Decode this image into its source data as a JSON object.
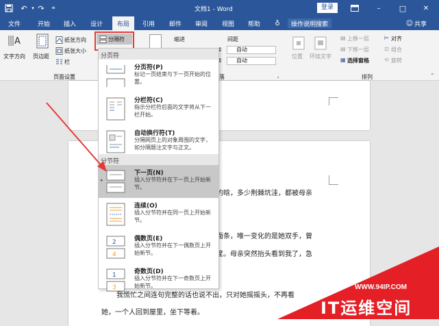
{
  "titlebar": {
    "title": "文档1 - Word",
    "login": "登录",
    "min": "–",
    "max": "□",
    "close": "✕",
    "accent": "#2b579a"
  },
  "tabs": [
    {
      "label": "文件"
    },
    {
      "label": "开始"
    },
    {
      "label": "插入"
    },
    {
      "label": "设计"
    },
    {
      "label": "布局"
    },
    {
      "label": "引用"
    },
    {
      "label": "邮件"
    },
    {
      "label": "审阅"
    },
    {
      "label": "视图"
    },
    {
      "label": "帮助"
    }
  ],
  "search": {
    "label": "操作说明搜索"
  },
  "share": {
    "label": "共享"
  },
  "ribbon": {
    "text_direction": "文字方向",
    "margins": "页边距",
    "orientation": "纸张方向",
    "size": "纸张大小",
    "columns": "栏",
    "breaks": "分隔符",
    "group_page_setup": "页面设置",
    "indent": "缩进",
    "spacing": "间距",
    "spacing_before": "自动",
    "spacing_after": "自动",
    "group_paragraph": "落",
    "position": "位置",
    "wrap_text": "环绕文字",
    "bring_forward": "上移一层",
    "send_backward": "下移一层",
    "selection_pane": "选择窗格",
    "align": "对齐",
    "group": "组合",
    "rotate": "旋转",
    "group_arrange": "排列"
  },
  "dropdown": {
    "header_page_breaks": "分页符",
    "header_section_breaks": "分节符",
    "items": [
      {
        "title": "分页符(P)",
        "desc": "标记一页结束与下一页开始的位置。"
      },
      {
        "title": "分栏符(C)",
        "desc": "指示分栏符后面的文字将从下一栏开始。"
      },
      {
        "title": "自动换行符(T)",
        "desc": "分隔网页上的对象周围的文字，如分隔题注文字与正文。"
      },
      {
        "title": "下一页(N)",
        "desc": "插入分节符并在下一页上开始新节。"
      },
      {
        "title": "连续(O)",
        "desc": "插入分节符并在同一页上开始新节。"
      },
      {
        "title": "偶数页(E)",
        "desc": "插入分节符并在下一偶数页上开始新节。"
      },
      {
        "title": "奇数页(D)",
        "desc": "插入分节符并在下一奇数页上开始新节。"
      }
    ]
  },
  "document": {
    "lines": [
      "的晗，多少荆棘坑洼，都被母亲",
      "面条，唯一变化的是她双手，曾",
      "筐。母亲突然抬头看到我了，急",
      "我慌忙之间连句完整的话也说不出，只对她摇摇头，不再看",
      "她，一个人回到屋里，坐下等着。"
    ]
  },
  "watermark": {
    "url": "WWW.94IP.COM",
    "brand": "IT运维空间",
    "color": "#e41f26"
  }
}
